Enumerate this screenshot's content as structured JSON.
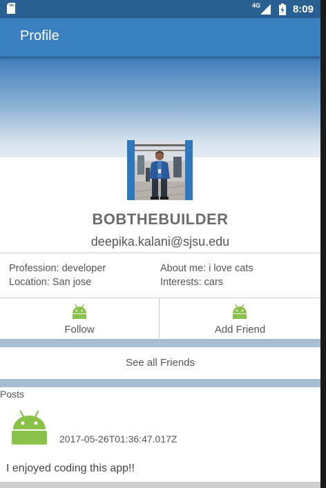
{
  "status_bar": {
    "network": "4G",
    "time": "8:09"
  },
  "app_bar": {
    "title": "Profile"
  },
  "profile": {
    "username": "BOBTHEBUILDER",
    "email": "deepika.kalani@sjsu.edu",
    "profession": "Profession: developer",
    "location": "Location: San jose",
    "about": "About me: i love cats",
    "interests": "Interests: cars"
  },
  "actions": {
    "follow_label": "Follow",
    "add_friend_label": "Add Friend",
    "see_all_friends_label": "See all Friends"
  },
  "posts": {
    "section_label": "Posts",
    "items": [
      {
        "timestamp": "2017-05-26T01:36:47.017Z",
        "text": "I enjoyed coding this app!!",
        "icon": "android-icon"
      }
    ]
  },
  "colors": {
    "status_bar": "#2a5f91",
    "app_bar": "#3a7fc0",
    "separator": "#a7bdd1",
    "android_green": "#8ac249"
  }
}
